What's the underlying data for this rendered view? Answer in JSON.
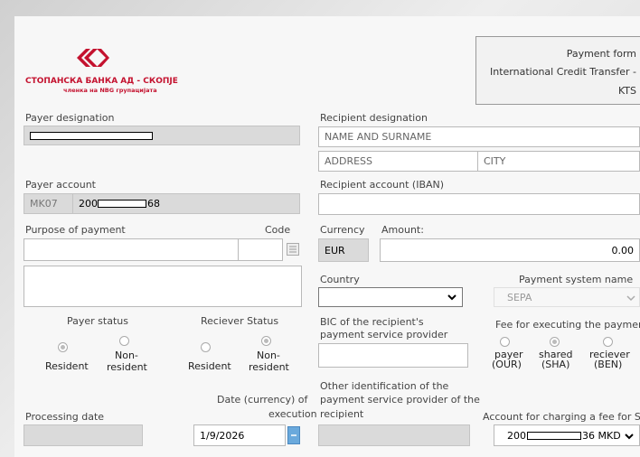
{
  "bank": {
    "name": "СТОПАНСКА БАНКА АД - СКОПЈЕ",
    "subtitle": "членка на NBG групацијата",
    "logo_color": "#c4122f"
  },
  "form_header": {
    "line1": "Payment form",
    "line2": "International Credit Transfer -",
    "line3": "KTS"
  },
  "payer": {
    "designation_label": "Payer designation",
    "account_label": "Payer account",
    "account_prefix": "MK07",
    "account_start": "200",
    "account_end": "68"
  },
  "recipient": {
    "designation_label": "Recipient designation",
    "name_placeholder": "NAME AND SURNAME",
    "address_placeholder": "ADDRESS",
    "city_placeholder": "CITY",
    "account_label": "Recipient account (IBAN)"
  },
  "purpose": {
    "label": "Purpose of payment",
    "code_label": "Code"
  },
  "currency": {
    "label": "Currency",
    "value": "EUR",
    "amount_label": "Amount:",
    "amount_value": "0.00"
  },
  "country": {
    "label": "Country",
    "value": ""
  },
  "payment_system": {
    "label": "Payment system name",
    "value": "SEPA"
  },
  "status": {
    "payer_label": "Payer status",
    "receiver_label": "Reciever Status",
    "resident": "Resident",
    "non": "Non-",
    "resident_lc": "resident"
  },
  "bic": {
    "label_line1": "BIC of the recipient's",
    "label_line2": "payment service provider"
  },
  "fee": {
    "label": "Fee for executing the payment",
    "payer_l1": "payer",
    "payer_l2": "(OUR)",
    "shared_l1": "shared",
    "shared_l2": "(SHA)",
    "ben_l1": "reciever",
    "ben_l2": "(BEN)"
  },
  "other_id": {
    "line1": "Other identification of the",
    "line2": "payment service provider of the",
    "line3": "recipient"
  },
  "dates": {
    "processing_label": "Processing date",
    "execution_label_l1": "Date (currency) of",
    "execution_label_l2": "execution",
    "execution_value": "1/9/2026"
  },
  "fee_account": {
    "label": "Account for charging a fee for SB",
    "start": "200",
    "end": "36 MKD"
  }
}
